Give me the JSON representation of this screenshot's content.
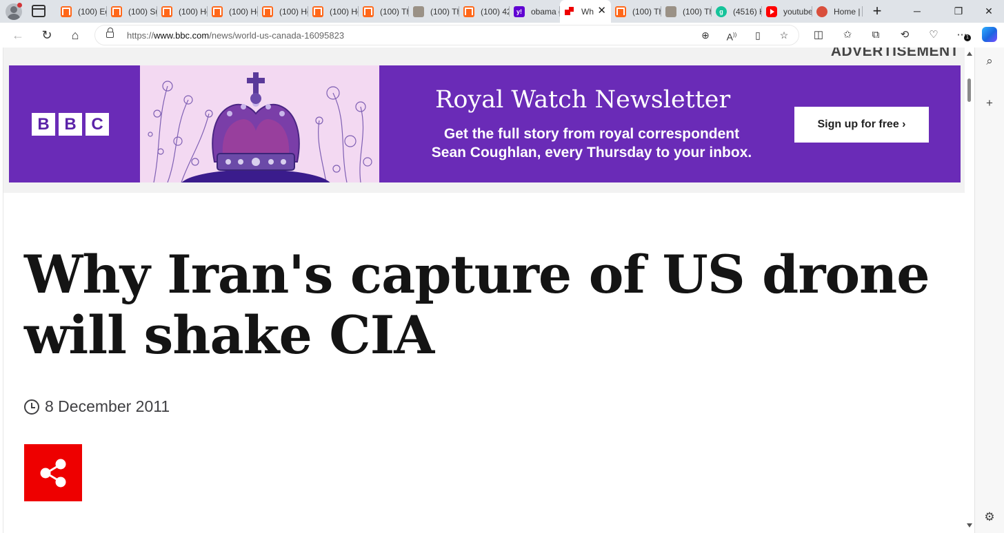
{
  "browser": {
    "tabs": [
      {
        "label": "(100) Ed",
        "favicon": "substack-icon"
      },
      {
        "label": "(100) Su",
        "favicon": "substack-icon"
      },
      {
        "label": "(100) Ho",
        "favicon": "substack-icon"
      },
      {
        "label": "(100) Ho",
        "favicon": "substack-icon"
      },
      {
        "label": "(100) Ho",
        "favicon": "substack-icon"
      },
      {
        "label": "(100) Ho",
        "favicon": "substack-icon"
      },
      {
        "label": "(100) Th",
        "favicon": "substack-icon"
      },
      {
        "label": "(100) Th",
        "favicon": "image-icon"
      },
      {
        "label": "(100) 42",
        "favicon": "substack-icon"
      },
      {
        "label": "obama g",
        "favicon": "yahoo-icon"
      },
      {
        "label": "Wh",
        "favicon": "bbc-icon",
        "active": true
      },
      {
        "label": "(100) Th",
        "favicon": "substack-icon"
      },
      {
        "label": "(100) Th",
        "favicon": "image-icon"
      },
      {
        "label": "(4516) H",
        "favicon": "grammarly-icon"
      },
      {
        "label": "youtube",
        "favicon": "youtube-icon"
      },
      {
        "label": "Home |",
        "favicon": "home-icon"
      }
    ],
    "favicon_letters": {
      "yahoo": "y!",
      "grammarly": "g"
    },
    "address": {
      "scheme": "https://",
      "host": "www.bbc.com",
      "path": "/news/world-us-canada-16095823"
    },
    "extension_badge": "1",
    "colors": {
      "accent_red": "#ee0000",
      "ad_purple": "#6a2bb7"
    }
  },
  "page": {
    "ad_label": "ADVERTISEMENT",
    "ad": {
      "bbc_letters": [
        "B",
        "B",
        "C"
      ],
      "headline": "Royal Watch Newsletter",
      "body_line1": "Get the full story from royal correspondent",
      "body_line2": "Sean Coughlan, every Thursday to your inbox.",
      "cta": "Sign up for free ›"
    },
    "article": {
      "title": "Why Iran's capture of US drone will shake CIA",
      "date": "8 December 2011"
    }
  }
}
